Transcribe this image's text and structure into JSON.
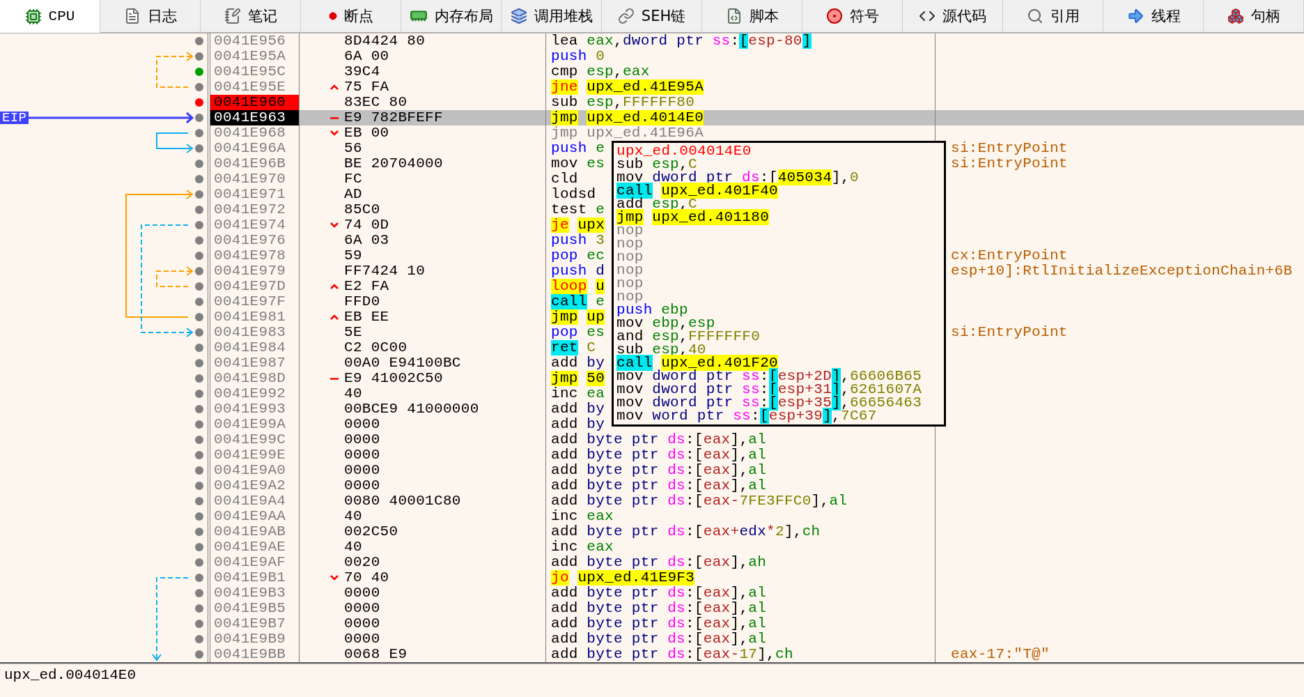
{
  "tabs": [
    {
      "label": "CPU",
      "selected": true
    },
    {
      "label": "日志",
      "selected": false
    },
    {
      "label": "笔记",
      "selected": false
    },
    {
      "label": "断点",
      "selected": false
    },
    {
      "label": "内存布局",
      "selected": false
    },
    {
      "label": "调用堆栈",
      "selected": false
    },
    {
      "label": "SEH链",
      "selected": false
    },
    {
      "label": "脚本",
      "selected": false
    },
    {
      "label": "符号",
      "selected": false
    },
    {
      "label": "源代码",
      "selected": false
    },
    {
      "label": "引用",
      "selected": false
    },
    {
      "label": "线程",
      "selected": false
    },
    {
      "label": "句柄",
      "selected": false
    }
  ],
  "eip_label": "EIP",
  "rows": [
    {
      "address": "0041E956",
      "bytes": "8D4424 80",
      "color": "#808080",
      "breakpoint": false,
      "eip": false,
      "selected": false,
      "instruction": [
        {
          "text": "lea",
          "kind": "mn"
        },
        {
          "text": "eax",
          "kind": "reg"
        },
        {
          "text": ",",
          "kind": "p"
        },
        {
          "text": "dword ptr",
          "kind": "size"
        },
        {
          "text": "ss",
          "kind": "seg"
        },
        {
          "text": ":",
          "kind": "p"
        },
        {
          "text": "[",
          "kind": "brh"
        },
        {
          "text": "esp-80",
          "kind": "mem"
        },
        {
          "text": "]",
          "kind": "brh"
        }
      ]
    },
    {
      "address": "0041E95A",
      "bytes": "6A 00",
      "color": "#808080",
      "breakpoint": false,
      "eip": false,
      "selected": false,
      "instruction": [
        {
          "text": "push",
          "kind": "push"
        },
        {
          "text": "0",
          "kind": "num"
        }
      ]
    },
    {
      "address": "0041E95C",
      "bytes": "39C4",
      "color": "#00a000",
      "breakpoint": false,
      "eip": false,
      "selected": false,
      "instruction": [
        {
          "text": "cmp",
          "kind": "mn"
        },
        {
          "text": "esp",
          "kind": "reg"
        },
        {
          "text": ",",
          "kind": "p"
        },
        {
          "text": "eax",
          "kind": "reg"
        }
      ]
    },
    {
      "address": "0041E95E",
      "bytes": "75 FA",
      "color": "#808080",
      "breakpoint": false,
      "eip": false,
      "jump": {
        "kind": "up"
      },
      "selected": false,
      "instruction": [
        {
          "text": "jne",
          "kind": "jcc"
        },
        {
          "text": "upx_ed.41E95A",
          "kind": "addr"
        }
      ]
    },
    {
      "address": "0041E960",
      "bytes": "83EC 80",
      "color": "#ff0000",
      "breakpoint": true,
      "eip": false,
      "selected": false,
      "instruction": [
        {
          "text": "sub",
          "kind": "mn"
        },
        {
          "text": "esp",
          "kind": "reg"
        },
        {
          "text": ",",
          "kind": "p"
        },
        {
          "text": "FFFFFF80",
          "kind": "num"
        }
      ]
    },
    {
      "address": "0041E963",
      "bytes": "E9 782BFEFF",
      "color": "#808080",
      "breakpoint": false,
      "eip": true,
      "jump": {
        "kind": "dash"
      },
      "selected": true,
      "instruction": [
        {
          "text": "jmp",
          "kind": "jmp"
        },
        {
          "text": "upx_ed.4014E0",
          "kind": "addr"
        }
      ]
    },
    {
      "address": "0041E968",
      "bytes": "EB 00",
      "color": "#808080",
      "breakpoint": false,
      "eip": false,
      "jump": {
        "kind": "down"
      },
      "selected": false,
      "instruction": [
        {
          "text": "jmp",
          "kind": "muted"
        },
        {
          "text": "upx_ed.41E96A",
          "kind": "muted"
        }
      ]
    },
    {
      "address": "0041E96A",
      "bytes": "56",
      "color": "#808080",
      "breakpoint": false,
      "eip": false,
      "selected": false,
      "instruction": [
        {
          "text": "push",
          "kind": "push"
        },
        {
          "text": "e",
          "kind": "reg"
        }
      ],
      "comment": "si:EntryPoint"
    },
    {
      "address": "0041E96B",
      "bytes": "BE 20704000",
      "color": "#808080",
      "breakpoint": false,
      "eip": false,
      "selected": false,
      "instruction": [
        {
          "text": "mov",
          "kind": "mn"
        },
        {
          "text": "es",
          "kind": "reg"
        }
      ],
      "comment": "si:EntryPoint"
    },
    {
      "address": "0041E970",
      "bytes": "FC",
      "color": "#808080",
      "breakpoint": false,
      "eip": false,
      "selected": false,
      "instruction": [
        {
          "text": "cld",
          "kind": "mn"
        }
      ]
    },
    {
      "address": "0041E971",
      "bytes": "AD",
      "color": "#808080",
      "breakpoint": false,
      "eip": false,
      "selected": false,
      "instruction": [
        {
          "text": "lodsd",
          "kind": "mn"
        }
      ]
    },
    {
      "address": "0041E972",
      "bytes": "85C0",
      "color": "#808080",
      "breakpoint": false,
      "eip": false,
      "selected": false,
      "instruction": [
        {
          "text": "test",
          "kind": "mn"
        },
        {
          "text": "e",
          "kind": "reg"
        }
      ]
    },
    {
      "address": "0041E974",
      "bytes": "74 0D",
      "color": "#808080",
      "breakpoint": false,
      "eip": false,
      "jump": {
        "kind": "down"
      },
      "selected": false,
      "instruction": [
        {
          "text": "je",
          "kind": "jcc"
        },
        {
          "text": "upx",
          "kind": "addr"
        }
      ]
    },
    {
      "address": "0041E976",
      "bytes": "6A 03",
      "color": "#808080",
      "breakpoint": false,
      "eip": false,
      "selected": false,
      "instruction": [
        {
          "text": "push",
          "kind": "push"
        },
        {
          "text": "3",
          "kind": "num"
        }
      ]
    },
    {
      "address": "0041E978",
      "bytes": "59",
      "color": "#808080",
      "breakpoint": false,
      "eip": false,
      "selected": false,
      "instruction": [
        {
          "text": "pop",
          "kind": "push"
        },
        {
          "text": "ec",
          "kind": "reg"
        }
      ],
      "comment": "cx:EntryPoint"
    },
    {
      "address": "0041E979",
      "bytes": "FF7424 10",
      "color": "#808080",
      "breakpoint": false,
      "eip": false,
      "selected": false,
      "instruction": [
        {
          "text": "push",
          "kind": "push"
        },
        {
          "text": "d",
          "kind": "size"
        }
      ],
      "comment": "esp+10]:RtlInitializeExceptionChain+6B"
    },
    {
      "address": "0041E97D",
      "bytes": "E2 FA",
      "color": "#808080",
      "breakpoint": false,
      "eip": false,
      "jump": {
        "kind": "up"
      },
      "selected": false,
      "instruction": [
        {
          "text": "loop",
          "kind": "jcc"
        },
        {
          "text": "u",
          "kind": "addr"
        }
      ]
    },
    {
      "address": "0041E97F",
      "bytes": "FFD0",
      "color": "#808080",
      "breakpoint": false,
      "eip": false,
      "selected": false,
      "instruction": [
        {
          "text": "call",
          "kind": "call"
        },
        {
          "text": "e",
          "kind": "reg"
        }
      ]
    },
    {
      "address": "0041E981",
      "bytes": "EB EE",
      "color": "#808080",
      "breakpoint": false,
      "eip": false,
      "jump": {
        "kind": "up"
      },
      "selected": false,
      "instruction": [
        {
          "text": "jmp",
          "kind": "jmp"
        },
        {
          "text": "up",
          "kind": "addr"
        }
      ]
    },
    {
      "address": "0041E983",
      "bytes": "5E",
      "color": "#808080",
      "breakpoint": false,
      "eip": false,
      "selected": false,
      "instruction": [
        {
          "text": "pop",
          "kind": "push"
        },
        {
          "text": "es",
          "kind": "reg"
        }
      ],
      "comment": "si:EntryPoint"
    },
    {
      "address": "0041E984",
      "bytes": "C2 0C00",
      "color": "#808080",
      "breakpoint": false,
      "eip": false,
      "selected": false,
      "instruction": [
        {
          "text": "ret",
          "kind": "call"
        },
        {
          "text": "C",
          "kind": "num"
        }
      ]
    },
    {
      "address": "0041E987",
      "bytes": "00A0 E94100BC",
      "color": "#808080",
      "breakpoint": false,
      "eip": false,
      "selected": false,
      "instruction": [
        {
          "text": "add",
          "kind": "mn"
        },
        {
          "text": "by",
          "kind": "size"
        }
      ]
    },
    {
      "address": "0041E98D",
      "bytes": "E9 41002C50",
      "color": "#808080",
      "breakpoint": false,
      "eip": false,
      "jump": {
        "kind": "dash"
      },
      "selected": false,
      "instruction": [
        {
          "text": "jmp",
          "kind": "jmp"
        },
        {
          "text": "50",
          "kind": "addr"
        }
      ]
    },
    {
      "address": "0041E992",
      "bytes": "40",
      "color": "#808080",
      "breakpoint": false,
      "eip": false,
      "selected": false,
      "instruction": [
        {
          "text": "inc",
          "kind": "mn"
        },
        {
          "text": "ea",
          "kind": "reg"
        }
      ]
    },
    {
      "address": "0041E993",
      "bytes": "00BCE9 41000000",
      "color": "#808080",
      "breakpoint": false,
      "eip": false,
      "selected": false,
      "instruction": [
        {
          "text": "add",
          "kind": "mn"
        },
        {
          "text": "by",
          "kind": "size"
        }
      ]
    },
    {
      "address": "0041E99A",
      "bytes": "0000",
      "color": "#808080",
      "breakpoint": false,
      "eip": false,
      "selected": false,
      "instruction": [
        {
          "text": "add",
          "kind": "mn"
        },
        {
          "text": "by",
          "kind": "size"
        }
      ]
    },
    {
      "address": "0041E99C",
      "bytes": "0000",
      "color": "#808080",
      "breakpoint": false,
      "eip": false,
      "selected": false,
      "instruction": [
        {
          "text": "add",
          "kind": "mn"
        },
        {
          "text": "byte ptr",
          "kind": "size"
        },
        {
          "text": "ds",
          "kind": "seg"
        },
        {
          "text": ":",
          "kind": "p"
        },
        {
          "text": "[",
          "kind": "p"
        },
        {
          "text": "eax",
          "kind": "mem"
        },
        {
          "text": "]",
          "kind": "p"
        },
        {
          "text": ",",
          "kind": "p"
        },
        {
          "text": "al",
          "kind": "reg"
        }
      ]
    },
    {
      "address": "0041E99E",
      "bytes": "0000",
      "color": "#808080",
      "breakpoint": false,
      "eip": false,
      "selected": false,
      "instruction": [
        {
          "text": "add",
          "kind": "mn"
        },
        {
          "text": "byte ptr",
          "kind": "size"
        },
        {
          "text": "ds",
          "kind": "seg"
        },
        {
          "text": ":",
          "kind": "p"
        },
        {
          "text": "[",
          "kind": "p"
        },
        {
          "text": "eax",
          "kind": "mem"
        },
        {
          "text": "]",
          "kind": "p"
        },
        {
          "text": ",",
          "kind": "p"
        },
        {
          "text": "al",
          "kind": "reg"
        }
      ]
    },
    {
      "address": "0041E9A0",
      "bytes": "0000",
      "color": "#808080",
      "breakpoint": false,
      "eip": false,
      "selected": false,
      "instruction": [
        {
          "text": "add",
          "kind": "mn"
        },
        {
          "text": "byte ptr",
          "kind": "size"
        },
        {
          "text": "ds",
          "kind": "seg"
        },
        {
          "text": ":",
          "kind": "p"
        },
        {
          "text": "[",
          "kind": "p"
        },
        {
          "text": "eax",
          "kind": "mem"
        },
        {
          "text": "]",
          "kind": "p"
        },
        {
          "text": ",",
          "kind": "p"
        },
        {
          "text": "al",
          "kind": "reg"
        }
      ]
    },
    {
      "address": "0041E9A2",
      "bytes": "0000",
      "color": "#808080",
      "breakpoint": false,
      "eip": false,
      "selected": false,
      "instruction": [
        {
          "text": "add",
          "kind": "mn"
        },
        {
          "text": "byte ptr",
          "kind": "size"
        },
        {
          "text": "ds",
          "kind": "seg"
        },
        {
          "text": ":",
          "kind": "p"
        },
        {
          "text": "[",
          "kind": "p"
        },
        {
          "text": "eax",
          "kind": "mem"
        },
        {
          "text": "]",
          "kind": "p"
        },
        {
          "text": ",",
          "kind": "p"
        },
        {
          "text": "al",
          "kind": "reg"
        }
      ]
    },
    {
      "address": "0041E9A4",
      "bytes": "0080 40001C80",
      "color": "#808080",
      "breakpoint": false,
      "eip": false,
      "selected": false,
      "instruction": [
        {
          "text": "add",
          "kind": "mn"
        },
        {
          "text": "byte ptr",
          "kind": "size"
        },
        {
          "text": "ds",
          "kind": "seg"
        },
        {
          "text": ":",
          "kind": "p"
        },
        {
          "text": "[",
          "kind": "p"
        },
        {
          "text": "eax",
          "kind": "mem"
        },
        {
          "text": "-",
          "kind": "mem"
        },
        {
          "text": "7FE3FFC0",
          "kind": "num"
        },
        {
          "text": "]",
          "kind": "p"
        },
        {
          "text": ",",
          "kind": "p"
        },
        {
          "text": "al",
          "kind": "reg"
        }
      ]
    },
    {
      "address": "0041E9AA",
      "bytes": "40",
      "color": "#808080",
      "breakpoint": false,
      "eip": false,
      "selected": false,
      "instruction": [
        {
          "text": "inc",
          "kind": "mn"
        },
        {
          "text": "eax",
          "kind": "reg"
        }
      ]
    },
    {
      "address": "0041E9AB",
      "bytes": "002C50",
      "color": "#808080",
      "breakpoint": false,
      "eip": false,
      "selected": false,
      "instruction": [
        {
          "text": "add",
          "kind": "mn"
        },
        {
          "text": "byte ptr",
          "kind": "size"
        },
        {
          "text": "ds",
          "kind": "seg"
        },
        {
          "text": ":",
          "kind": "p"
        },
        {
          "text": "[",
          "kind": "p"
        },
        {
          "text": "eax",
          "kind": "mem"
        },
        {
          "text": "+",
          "kind": "mem"
        },
        {
          "text": "edx",
          "kind": "idx"
        },
        {
          "text": "*",
          "kind": "mem"
        },
        {
          "text": "2",
          "kind": "num"
        },
        {
          "text": "]",
          "kind": "p"
        },
        {
          "text": ",",
          "kind": "p"
        },
        {
          "text": "ch",
          "kind": "reg"
        }
      ]
    },
    {
      "address": "0041E9AE",
      "bytes": "40",
      "color": "#808080",
      "breakpoint": false,
      "eip": false,
      "selected": false,
      "instruction": [
        {
          "text": "inc",
          "kind": "mn"
        },
        {
          "text": "eax",
          "kind": "reg"
        }
      ]
    },
    {
      "address": "0041E9AF",
      "bytes": "0020",
      "color": "#808080",
      "breakpoint": false,
      "eip": false,
      "selected": false,
      "instruction": [
        {
          "text": "add",
          "kind": "mn"
        },
        {
          "text": "byte ptr",
          "kind": "size"
        },
        {
          "text": "ds",
          "kind": "seg"
        },
        {
          "text": ":",
          "kind": "p"
        },
        {
          "text": "[",
          "kind": "p"
        },
        {
          "text": "eax",
          "kind": "mem"
        },
        {
          "text": "]",
          "kind": "p"
        },
        {
          "text": ",",
          "kind": "p"
        },
        {
          "text": "ah",
          "kind": "reg"
        }
      ]
    },
    {
      "address": "0041E9B1",
      "bytes": "70 40",
      "color": "#808080",
      "breakpoint": false,
      "eip": false,
      "jump": {
        "kind": "down"
      },
      "selected": false,
      "instruction": [
        {
          "text": "jo",
          "kind": "jcc"
        },
        {
          "text": "upx_ed.41E9F3",
          "kind": "addr"
        }
      ]
    },
    {
      "address": "0041E9B3",
      "bytes": "0000",
      "color": "#808080",
      "breakpoint": false,
      "eip": false,
      "selected": false,
      "instruction": [
        {
          "text": "add",
          "kind": "mn"
        },
        {
          "text": "byte ptr",
          "kind": "size"
        },
        {
          "text": "ds",
          "kind": "seg"
        },
        {
          "text": ":",
          "kind": "p"
        },
        {
          "text": "[",
          "kind": "p"
        },
        {
          "text": "eax",
          "kind": "mem"
        },
        {
          "text": "]",
          "kind": "p"
        },
        {
          "text": ",",
          "kind": "p"
        },
        {
          "text": "al",
          "kind": "reg"
        }
      ]
    },
    {
      "address": "0041E9B5",
      "bytes": "0000",
      "color": "#808080",
      "breakpoint": false,
      "eip": false,
      "selected": false,
      "instruction": [
        {
          "text": "add",
          "kind": "mn"
        },
        {
          "text": "byte ptr",
          "kind": "size"
        },
        {
          "text": "ds",
          "kind": "seg"
        },
        {
          "text": ":",
          "kind": "p"
        },
        {
          "text": "[",
          "kind": "p"
        },
        {
          "text": "eax",
          "kind": "mem"
        },
        {
          "text": "]",
          "kind": "p"
        },
        {
          "text": ",",
          "kind": "p"
        },
        {
          "text": "al",
          "kind": "reg"
        }
      ]
    },
    {
      "address": "0041E9B7",
      "bytes": "0000",
      "color": "#808080",
      "breakpoint": false,
      "eip": false,
      "selected": false,
      "instruction": [
        {
          "text": "add",
          "kind": "mn"
        },
        {
          "text": "byte ptr",
          "kind": "size"
        },
        {
          "text": "ds",
          "kind": "seg"
        },
        {
          "text": ":",
          "kind": "p"
        },
        {
          "text": "[",
          "kind": "p"
        },
        {
          "text": "eax",
          "kind": "mem"
        },
        {
          "text": "]",
          "kind": "p"
        },
        {
          "text": ",",
          "kind": "p"
        },
        {
          "text": "al",
          "kind": "reg"
        }
      ]
    },
    {
      "address": "0041E9B9",
      "bytes": "0000",
      "color": "#808080",
      "breakpoint": false,
      "eip": false,
      "selected": false,
      "instruction": [
        {
          "text": "add",
          "kind": "mn"
        },
        {
          "text": "byte ptr",
          "kind": "size"
        },
        {
          "text": "ds",
          "kind": "seg"
        },
        {
          "text": ":",
          "kind": "p"
        },
        {
          "text": "[",
          "kind": "p"
        },
        {
          "text": "eax",
          "kind": "mem"
        },
        {
          "text": "]",
          "kind": "p"
        },
        {
          "text": ",",
          "kind": "p"
        },
        {
          "text": "al",
          "kind": "reg"
        }
      ]
    },
    {
      "address": "0041E9BB",
      "bytes": "0068 E9",
      "color": "#808080",
      "breakpoint": false,
      "eip": false,
      "selected": false,
      "instruction": [
        {
          "text": "add",
          "kind": "mn"
        },
        {
          "text": "byte ptr",
          "kind": "size"
        },
        {
          "text": "ds",
          "kind": "seg"
        },
        {
          "text": ":",
          "kind": "p"
        },
        {
          "text": "[",
          "kind": "p"
        },
        {
          "text": "eax",
          "kind": "mem"
        },
        {
          "text": "-",
          "kind": "mem"
        },
        {
          "text": "17",
          "kind": "num"
        },
        {
          "text": "]",
          "kind": "p"
        },
        {
          "text": ",",
          "kind": "p"
        },
        {
          "text": "ch",
          "kind": "reg"
        }
      ],
      "comment": "eax-17:\"T@\""
    }
  ],
  "tooltip": {
    "title": "upx_ed.004014E0",
    "lines": [
      [
        {
          "text": "sub",
          "kind": "mn"
        },
        {
          "text": "esp",
          "kind": "reg"
        },
        {
          "text": ",",
          "kind": "p"
        },
        {
          "text": "C",
          "kind": "num"
        }
      ],
      [
        {
          "text": "mov",
          "kind": "mn"
        },
        {
          "text": "dword ptr",
          "kind": "size"
        },
        {
          "text": "ds",
          "kind": "seg"
        },
        {
          "text": ":",
          "kind": "p"
        },
        {
          "text": "[",
          "kind": "p"
        },
        {
          "text": "405034",
          "kind": "addr"
        },
        {
          "text": "]",
          "kind": "p"
        },
        {
          "text": ",",
          "kind": "p"
        },
        {
          "text": "0",
          "kind": "num"
        }
      ],
      [
        {
          "text": "call",
          "kind": "call"
        },
        {
          "text": "upx_ed.401F40",
          "kind": "addr"
        }
      ],
      [
        {
          "text": "add",
          "kind": "mn"
        },
        {
          "text": "esp",
          "kind": "reg"
        },
        {
          "text": ",",
          "kind": "p"
        },
        {
          "text": "C",
          "kind": "num"
        }
      ],
      [
        {
          "text": "jmp",
          "kind": "jmp"
        },
        {
          "text": "upx_ed.401180",
          "kind": "addr"
        }
      ],
      [
        {
          "text": "nop",
          "kind": "muted"
        }
      ],
      [
        {
          "text": "nop",
          "kind": "muted"
        }
      ],
      [
        {
          "text": "nop",
          "kind": "muted"
        }
      ],
      [
        {
          "text": "nop",
          "kind": "muted"
        }
      ],
      [
        {
          "text": "nop",
          "kind": "muted"
        }
      ],
      [
        {
          "text": "nop",
          "kind": "muted"
        }
      ],
      [
        {
          "text": "push",
          "kind": "push"
        },
        {
          "text": "ebp",
          "kind": "reg"
        }
      ],
      [
        {
          "text": "mov",
          "kind": "mn"
        },
        {
          "text": "ebp",
          "kind": "reg"
        },
        {
          "text": ",",
          "kind": "p"
        },
        {
          "text": "esp",
          "kind": "reg"
        }
      ],
      [
        {
          "text": "and",
          "kind": "mn"
        },
        {
          "text": "esp",
          "kind": "reg"
        },
        {
          "text": ",",
          "kind": "p"
        },
        {
          "text": "FFFFFFF0",
          "kind": "num"
        }
      ],
      [
        {
          "text": "sub",
          "kind": "mn"
        },
        {
          "text": "esp",
          "kind": "reg"
        },
        {
          "text": ",",
          "kind": "p"
        },
        {
          "text": "40",
          "kind": "num"
        }
      ],
      [
        {
          "text": "call",
          "kind": "call"
        },
        {
          "text": "upx_ed.401F20",
          "kind": "addr"
        }
      ],
      [
        {
          "text": "mov",
          "kind": "mn"
        },
        {
          "text": "dword ptr",
          "kind": "size"
        },
        {
          "text": "ss",
          "kind": "seg"
        },
        {
          "text": ":",
          "kind": "p"
        },
        {
          "text": "[",
          "kind": "brh"
        },
        {
          "text": "esp+2D",
          "kind": "mem"
        },
        {
          "text": "]",
          "kind": "brh"
        },
        {
          "text": ",",
          "kind": "p"
        },
        {
          "text": "66606B65",
          "kind": "num"
        }
      ],
      [
        {
          "text": "mov",
          "kind": "mn"
        },
        {
          "text": "dword ptr",
          "kind": "size"
        },
        {
          "text": "ss",
          "kind": "seg"
        },
        {
          "text": ":",
          "kind": "p"
        },
        {
          "text": "[",
          "kind": "brh"
        },
        {
          "text": "esp+31",
          "kind": "mem"
        },
        {
          "text": "]",
          "kind": "brh"
        },
        {
          "text": ",",
          "kind": "p"
        },
        {
          "text": "6261607A",
          "kind": "num"
        }
      ],
      [
        {
          "text": "mov",
          "kind": "mn"
        },
        {
          "text": "dword ptr",
          "kind": "size"
        },
        {
          "text": "ss",
          "kind": "seg"
        },
        {
          "text": ":",
          "kind": "p"
        },
        {
          "text": "[",
          "kind": "brh"
        },
        {
          "text": "esp+35",
          "kind": "mem"
        },
        {
          "text": "]",
          "kind": "brh"
        },
        {
          "text": ",",
          "kind": "p"
        },
        {
          "text": "66656463",
          "kind": "num"
        }
      ],
      [
        {
          "text": "mov",
          "kind": "mn"
        },
        {
          "text": "word ptr",
          "kind": "size"
        },
        {
          "text": "ss",
          "kind": "seg"
        },
        {
          "text": ":",
          "kind": "p"
        },
        {
          "text": "[",
          "kind": "brh"
        },
        {
          "text": "esp+39",
          "kind": "mem"
        },
        {
          "text": "]",
          "kind": "brh"
        },
        {
          "text": ",",
          "kind": "p"
        },
        {
          "text": "7C67",
          "kind": "num"
        }
      ]
    ]
  },
  "status_bar": "upx_ed.004014E0"
}
